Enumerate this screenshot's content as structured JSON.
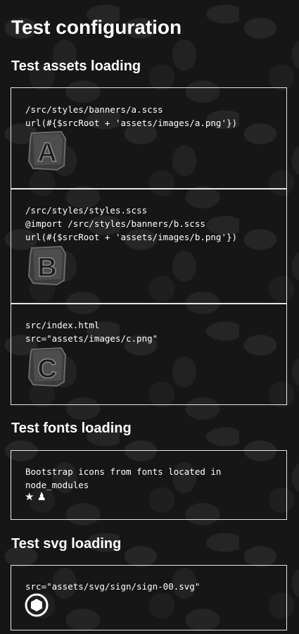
{
  "title": "Test configuration",
  "assets": {
    "heading": "Test assets loading",
    "items": [
      {
        "lines": [
          "/src/styles/banners/a.scss",
          "url(#{$srcRoot + 'assets/images/a.png'})"
        ],
        "letter": "A"
      },
      {
        "lines": [
          "/src/styles/styles.scss",
          "@import /src/styles/banners/b.scss",
          "url(#{$srcRoot + 'assets/images/b.png'})"
        ],
        "letter": "B"
      },
      {
        "lines": [
          "src/index.html",
          "src=\"assets/images/c.png\""
        ],
        "letter": "C"
      }
    ]
  },
  "fonts": {
    "heading": "Test fonts loading",
    "lines": [
      "Bootstrap icons from fonts located in",
      "node_modules"
    ],
    "icons": [
      "star-fill-icon",
      "chess-pawn-icon"
    ],
    "glyphs": [
      "★",
      "♟"
    ]
  },
  "svg": {
    "heading": "Test svg loading",
    "line": "src=\"assets/svg/sign/sign-00.svg\"",
    "icon": "hexagon-sign-icon"
  }
}
